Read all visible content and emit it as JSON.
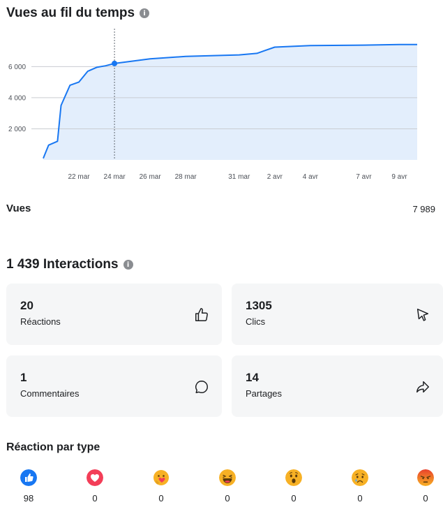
{
  "views_over_time": {
    "title": "Vues au fil du temps",
    "info_icon": "info-icon",
    "chart_data": {
      "type": "area",
      "x_labels": [
        "22 mar",
        "24 mar",
        "26 mar",
        "28 mar",
        "31 mar",
        "2 avr",
        "4 avr",
        "7 avr",
        "9 avr"
      ],
      "y_ticks": [
        "2 000",
        "4 000",
        "6 000"
      ],
      "y_tick_values": [
        2000,
        4000,
        6000
      ],
      "ylim": [
        0,
        7989
      ],
      "grid": true,
      "color": "#1877f2",
      "fill": "#e3eefc",
      "highlight_date": "24 mar",
      "highlight_value": 6200,
      "points": [
        [
          "20 mar",
          100
        ],
        [
          "20.3 mar",
          950
        ],
        [
          "20.8 mar",
          1200
        ],
        [
          "21 mar",
          3500
        ],
        [
          "21.5 mar",
          4800
        ],
        [
          "22 mar",
          5000
        ],
        [
          "22.5 mar",
          5700
        ],
        [
          "23 mar",
          5950
        ],
        [
          "23.5 mar",
          6050
        ],
        [
          "24 mar",
          6200
        ],
        [
          "26 mar",
          6500
        ],
        [
          "28 mar",
          6650
        ],
        [
          "31 mar",
          6750
        ],
        [
          "1 avr",
          6850
        ],
        [
          "2 avr",
          7250
        ],
        [
          "4 avr",
          7350
        ],
        [
          "7 avr",
          7380
        ],
        [
          "9 avr",
          7420
        ],
        [
          "10 avr",
          7420
        ]
      ]
    },
    "metric_label": "Vues",
    "metric_value": "7 989"
  },
  "interactions": {
    "title": "1 439 Interactions",
    "info_icon": "info-icon",
    "cards": [
      {
        "value": "20",
        "label": "Réactions",
        "icon": "thumbs-up-icon"
      },
      {
        "value": "1305",
        "label": "Clics",
        "icon": "cursor-icon"
      },
      {
        "value": "1",
        "label": "Commentaires",
        "icon": "comment-icon"
      },
      {
        "value": "14",
        "label": "Partages",
        "icon": "share-icon"
      }
    ]
  },
  "reactions_by_type": {
    "title": "Réaction par type",
    "items": [
      {
        "icon": "like-reaction-icon",
        "count": "98",
        "color": "#1877f2"
      },
      {
        "icon": "love-reaction-icon",
        "count": "0",
        "color": "#f33e58"
      },
      {
        "icon": "care-reaction-icon",
        "count": "0",
        "color": "#f7b125"
      },
      {
        "icon": "haha-reaction-icon",
        "count": "0",
        "color": "#f7b125"
      },
      {
        "icon": "wow-reaction-icon",
        "count": "0",
        "color": "#f7b125"
      },
      {
        "icon": "sad-reaction-icon",
        "count": "0",
        "color": "#f7b125"
      },
      {
        "icon": "angry-reaction-icon",
        "count": "0",
        "color": "#e9710f"
      }
    ]
  }
}
